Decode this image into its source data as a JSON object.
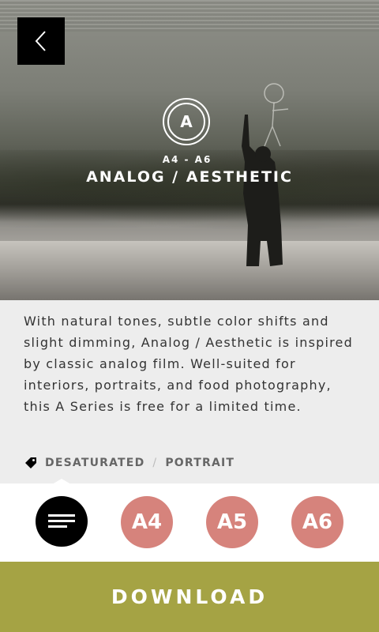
{
  "header": {
    "back_icon": "chevron-left-icon",
    "logo_letter": "A",
    "range": "A4 - A6",
    "title": "ANALOG / AESTHETIC"
  },
  "description": "With natural tones, subtle color shifts and slight dimming, Analog / Aesthetic is inspired by classic analog film. Well-suited for interiors, portraits, and food photography, this A Series is free for a limited time.",
  "tags": {
    "icon": "tag-icon",
    "items": [
      "DESATURATED",
      "PORTRAIT"
    ],
    "separator": "/"
  },
  "presets": {
    "menu_icon": "menu-lines-icon",
    "items": [
      "A4",
      "A5",
      "A6"
    ],
    "color": "#d6837c"
  },
  "download": {
    "label": "DOWNLOAD",
    "color": "#a5a344"
  }
}
